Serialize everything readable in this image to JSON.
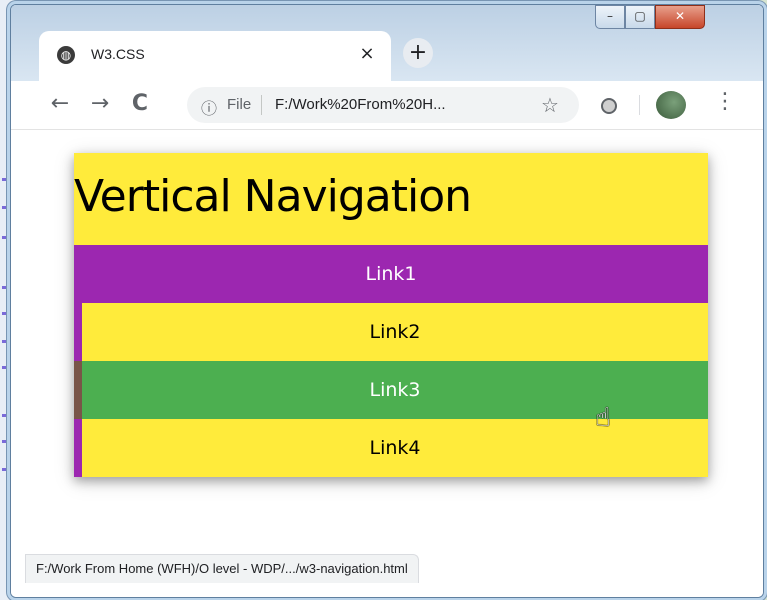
{
  "browser": {
    "tab": {
      "title": "W3.CSS",
      "close_glyph": "×"
    },
    "new_tab_glyph": "+",
    "window_controls": {
      "minimize_glyph": "–",
      "maximize_glyph": "▢",
      "close_glyph": "✕"
    },
    "toolbar": {
      "back_glyph": "←",
      "forward_glyph": "→",
      "reload_glyph": "C",
      "info_glyph": "ⓘ",
      "scheme_label": "File",
      "url": "F:/Work%20From%20H...",
      "star_glyph": "☆",
      "menu_glyph": "⋮"
    },
    "status_text": "F:/Work From Home (WFH)/O level - WDP/.../w3-navigation.html"
  },
  "page": {
    "title": "Vertical Navigation",
    "links": [
      {
        "label": "Link1",
        "state": "active"
      },
      {
        "label": "Link2",
        "state": "normal"
      },
      {
        "label": "Link3",
        "state": "hover"
      },
      {
        "label": "Link4",
        "state": "normal"
      }
    ]
  },
  "colors": {
    "header_bg": "#ffeb3b",
    "active_link_bg": "#9c27b0",
    "hover_link_bg": "#4caf50",
    "hover_border": "#795548",
    "link_border": "#9c27b0"
  }
}
